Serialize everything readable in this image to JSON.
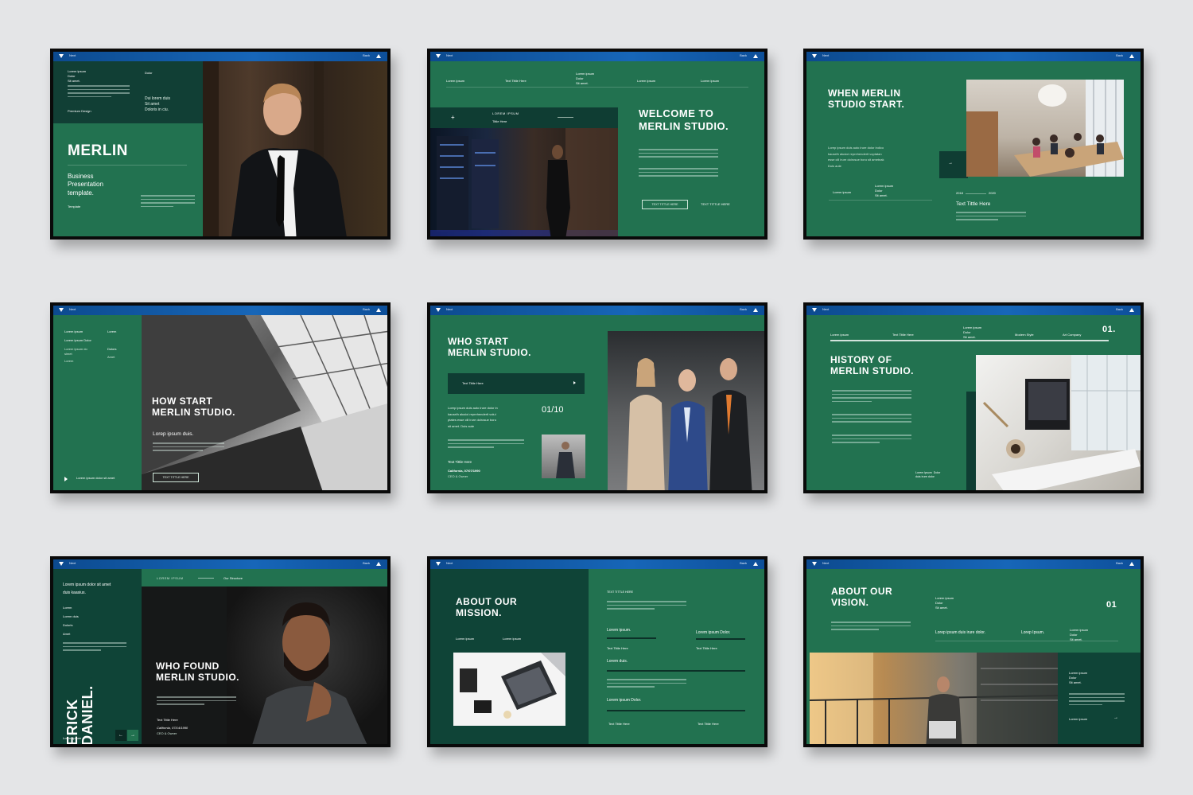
{
  "nav": {
    "next": "Next",
    "back": "Back"
  },
  "slide1": {
    "top_left": "Lorem ipsum\nDolor\nSit amet.",
    "top_mid": "Dolor",
    "mid_text": "Dui lorem duis\nSit amet\nDoloris in ciu.",
    "premium": "Premium Design",
    "title": "MERLIN",
    "subtitle": "Business\nPresentation\ntemplate.",
    "footer": "Template"
  },
  "slide2": {
    "header_items": [
      "Lorem ipsum",
      "Text Tittle Here",
      "Lorem ipsum\nDolor\nSit amet.",
      "Lorem ipsum",
      "Lorem ipsum"
    ],
    "label": "LOREM IPSUM",
    "sub_label": "Tittle Here",
    "title": "WELCOME TO\nMERLIN STUDIO.",
    "button": "TEXT TITTLE HERE",
    "link": "TEXT TITTLE HERE"
  },
  "slide3": {
    "title": "WHEN MERLIN\nSTUDIO START.",
    "body": "Lorep ipsum duis auto irure dolor indico\nkauselh alusioi reprehenderit voptatan\nesse cill irure dolrosue boru sit ametnak\nDuis aute",
    "label_a": "Lorem ipsum",
    "label_b": "Lorem ipsum\nDolor\nSit amet.",
    "year_a": "2018",
    "year_b": "2020",
    "text_title": "Text Tittle Here"
  },
  "slide4": {
    "menu": [
      "Lorem ipsum",
      "Lorem ipsum Dolor",
      "Lorem ipsum do\nsimet",
      "Lorem"
    ],
    "menu_b": [
      "Lorem",
      "Dolors",
      "Amet"
    ],
    "title": "HOW START\nMERLIN STUDIO.",
    "lead": "Lorep ipsum duis.",
    "button": "TEXT TITTLE HERE",
    "footer": "Lorem ipsum dolor sit amet"
  },
  "slide5": {
    "title": "WHO START\nMERLIN STUDIO.",
    "bar_label": "Text Tittle Here",
    "counter": "01/10",
    "body": "Lorep ipsum duis auto irure dolor in\nkauselh alusioi reprehenderit voluí\nptates esse cill irure dolrosue boru\nsit amet. Duis aute",
    "text_title": "Text Tittle Here",
    "location": "California, 07/07/1990",
    "role": "CEO & Owner"
  },
  "slide6": {
    "header_items": [
      "Lorem ipsum",
      "Text Tittle Here",
      "Lorem ipsum\nDolor\nSit amet.",
      "Modern Style",
      "Art Company"
    ],
    "number": "01.",
    "title": "HISTORY OF\nMERLIN STUDIO.",
    "caption": "Lorem ipsum  Dolor\nduis irure dolor"
  },
  "slide7": {
    "side_title": "Lorem ipsum dolor sit amet\nduis kaasius.",
    "side_list": [
      "Lorem",
      "Lorem duis",
      "Doloris",
      "Amet"
    ],
    "side_footer": "Lorem ipsum",
    "tag": "LOREM IPSUM",
    "tag_right": "Our Structure",
    "name": "ERICK\nDANIEL.",
    "title": "WHO FOUND\nMERLIN STUDIO.",
    "text_title": "Text Tittle  Here",
    "location": "California, 07/14/1990",
    "role": "CEO & Owner"
  },
  "slide8": {
    "title": "ABOUT OUR\nMISSION.",
    "label_a": "Lorem ipsum",
    "label_b": "Lorem ipsum",
    "head": "TEXT TITTLE HERE",
    "item1": "Lorem ipsum.",
    "item2": "Lorem ipsum  Dolor.",
    "item3": "Lorem duis.",
    "item4": "Lorem  ipsum  Dolor.",
    "small_a": "Text Tittle Here",
    "small_b": "Text Tittle Here",
    "foot_a": "Text Tittle Here",
    "foot_b": "Text Tittle Here"
  },
  "slide9": {
    "title": "ABOUT OUR\nVISION.",
    "label": "Lorem ipsum\nDolor\nSit amet.",
    "number": "01",
    "lead_a": "Lorep  ipsum duis irure dolor.",
    "lead_b": "Lorep  Ipsum.",
    "right_label": "Lorem ipsum\nDolor\nSit amet.",
    "right_label2": "Lorem ipsum\nDolor\nSit amet.",
    "right_link": "Lorem ipsum"
  }
}
